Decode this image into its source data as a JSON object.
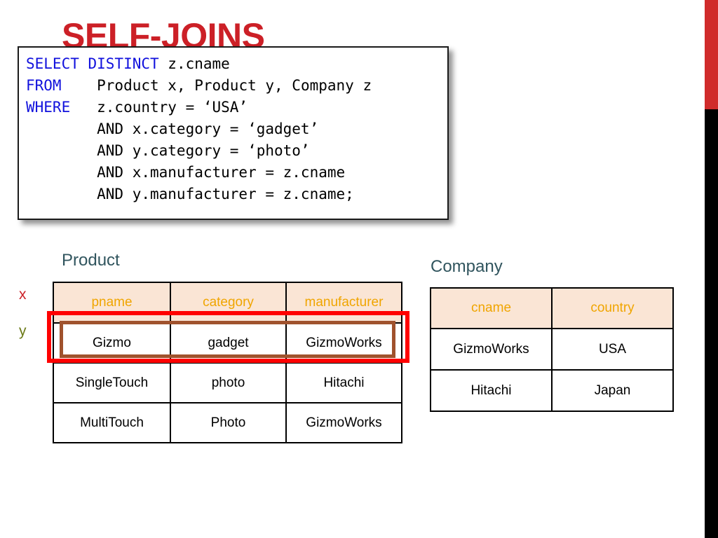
{
  "slide": {
    "title": "SELF-JOINS",
    "title_color": "#cc2027",
    "background": "#ffffff"
  },
  "decoration": {
    "right_bar_red_color": "#d02b2b",
    "right_bar_black_color": "#000000"
  },
  "code_box": {
    "keyword_color": "#1111dd",
    "text_color": "#000000",
    "lines": [
      {
        "keyword": "SELECT DISTINCT",
        "rest": " z.cname"
      },
      {
        "keyword": "FROM",
        "rest": "    Product x, Product y, Company z"
      },
      {
        "keyword": "WHERE",
        "rest": "   z.country = ‘USA’"
      },
      {
        "keyword": "",
        "rest": "        AND x.category = ‘gadget’"
      },
      {
        "keyword": "",
        "rest": "        AND y.category = ‘photo’"
      },
      {
        "keyword": "",
        "rest": "        AND x.manufacturer = z.cname"
      },
      {
        "keyword": "",
        "rest": "        AND y.manufacturer = z.cname;"
      }
    ],
    "full_text": "SELECT DISTINCT z.cname\nFROM    Product x, Product y, Company z\nWHERE   z.country = ‘USA’\n        AND x.category = ‘gadget’\n        AND y.category = ‘photo’\n        AND x.manufacturer = z.cname\n        AND y.manufacturer = z.cname;"
  },
  "product_table": {
    "caption": "Product",
    "caption_color": "#31555e",
    "header_bg": "#fae5d5",
    "header_text_color": "#f0a500",
    "columns": [
      "pname",
      "category",
      "manufacturer"
    ],
    "rows": [
      [
        "Gizmo",
        "gadget",
        "GizmoWorks"
      ],
      [
        "SingleTouch",
        "photo",
        "Hitachi"
      ],
      [
        "MultiTouch",
        "Photo",
        "GizmoWorks"
      ]
    ]
  },
  "company_table": {
    "caption": "Company",
    "caption_color": "#31555e",
    "header_bg": "#fae5d5",
    "header_text_color": "#f0a500",
    "columns": [
      "cname",
      "country"
    ],
    "rows": [
      [
        "GizmoWorks",
        "USA"
      ],
      [
        "Hitachi",
        "Japan"
      ]
    ]
  },
  "annotations": {
    "alias_x": "x",
    "alias_x_color": "#cc2027",
    "alias_y": "y",
    "alias_y_color": "#6b7a17",
    "highlight_outer_color": "#ff0000",
    "highlight_inner_color": "#a0522d"
  }
}
